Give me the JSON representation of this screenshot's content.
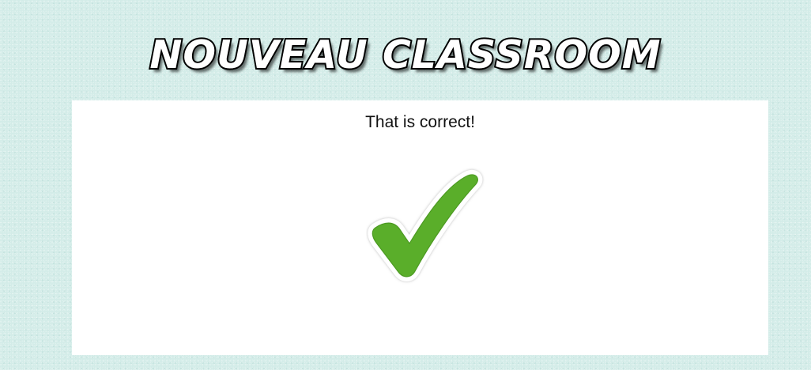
{
  "header": {
    "title": "NOUVEAU CLASSROOM"
  },
  "feedback": {
    "message": "That is correct!",
    "icon": "checkmark-icon",
    "icon_color": "#5aae2a"
  },
  "colors": {
    "page_background": "#d3ece8",
    "panel_background": "#ffffff",
    "title_fill": "#ffffff",
    "title_outline": "#000000"
  }
}
